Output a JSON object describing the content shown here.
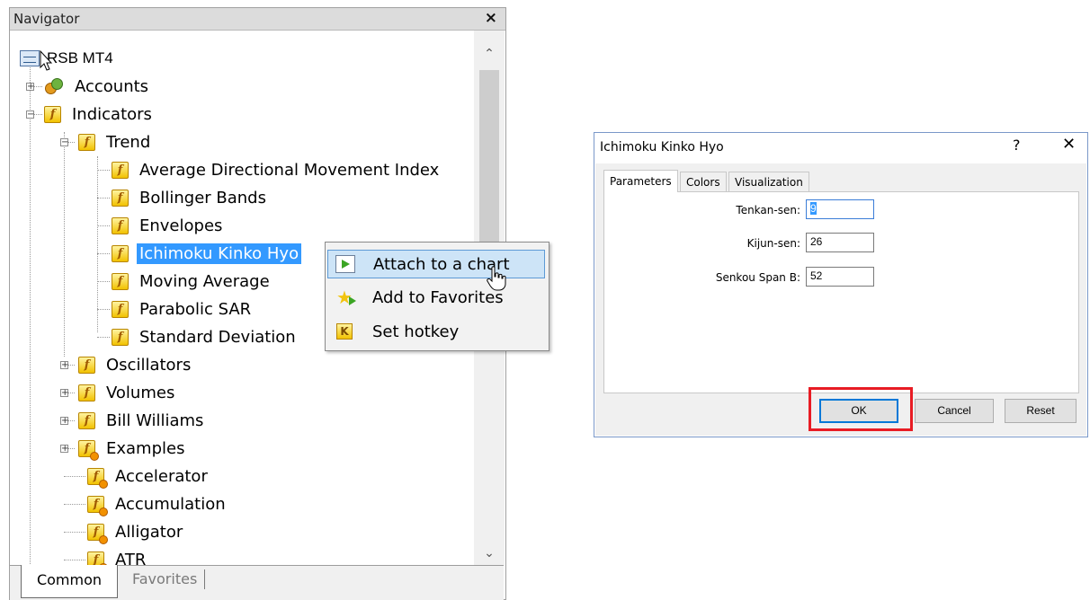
{
  "navigator": {
    "title": "Navigator",
    "close_symbol": "×",
    "scroll_up_symbol": "⌃",
    "scroll_down_symbol": "⌄",
    "root": "RSB MT4",
    "accounts": "Accounts",
    "indicators": "Indicators",
    "trend": "Trend",
    "trend_items": [
      "Average Directional Movement Index",
      "Bollinger Bands",
      "Envelopes",
      "Ichimoku Kinko Hyo",
      "Moving Average",
      "Parabolic SAR",
      "Standard Deviation"
    ],
    "groups": [
      "Oscillators",
      "Volumes",
      "Bill Williams",
      "Examples"
    ],
    "custom_items": [
      "Accelerator",
      "Accumulation",
      "Alligator",
      "ATR"
    ],
    "selected_item": "Ichimoku Kinko Hyo",
    "tabs": [
      "Common",
      "Favorites"
    ],
    "active_tab": "Common"
  },
  "context_menu": {
    "items": [
      "Attach to a chart",
      "Add to Favorites",
      "Set hotkey"
    ],
    "hovered": "Attach to a chart"
  },
  "dialog": {
    "title": "Ichimoku Kinko Hyo",
    "help_symbol": "?",
    "close_symbol": "✕",
    "tabs": [
      "Parameters",
      "Colors",
      "Visualization"
    ],
    "active_tab": "Parameters",
    "params": [
      {
        "label": "Tenkan-sen:",
        "value": "9"
      },
      {
        "label": "Kijun-sen:",
        "value": "26"
      },
      {
        "label": "Senkou Span B:",
        "value": "52"
      }
    ],
    "buttons": {
      "ok": "OK",
      "cancel": "Cancel",
      "reset": "Reset"
    }
  },
  "colors": {
    "selection": "#3399ff",
    "highlight_box": "#e81c24",
    "menu_hover": "#cde4f7"
  }
}
